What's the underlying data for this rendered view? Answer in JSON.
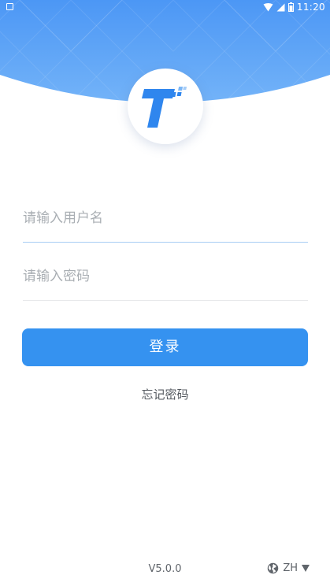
{
  "status_bar": {
    "time": "11:20"
  },
  "colors": {
    "header_gradient_top": "#4c97f5",
    "header_gradient_bottom": "#6fb1f8",
    "logo_blue": "#2f86ee",
    "primary_button": "#3592f0"
  },
  "login_form": {
    "username_placeholder": "请输入用户名",
    "password_placeholder": "请输入密码",
    "login_button_label": "登录",
    "forgot_password_label": "忘记密码"
  },
  "footer": {
    "version": "V5.0.0",
    "language": "ZH",
    "language_icon": "globe-icon",
    "dropdown_icon": "triangle-down-icon"
  }
}
